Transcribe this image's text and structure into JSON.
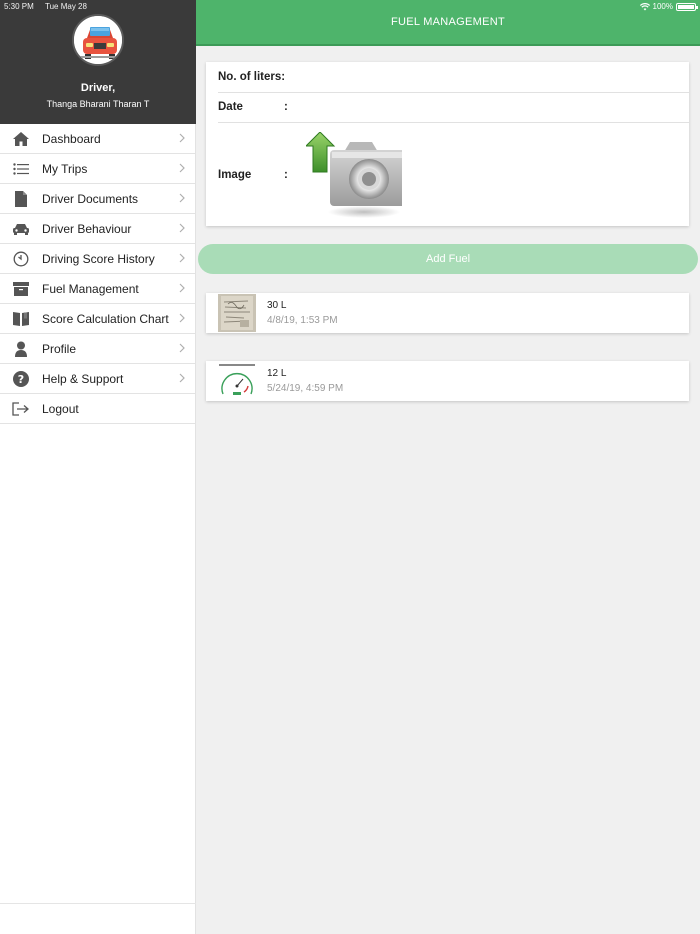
{
  "status_bar": {
    "time": "5:30 PM",
    "date": "Tue May 28",
    "battery": "100%"
  },
  "sidebar": {
    "driver_label": "Driver,",
    "driver_name": "Thanga Bharani Tharan T",
    "items": [
      {
        "label": "Dashboard",
        "icon": "home-icon",
        "has_chevron": true
      },
      {
        "label": "My Trips",
        "icon": "list-icon",
        "has_chevron": true
      },
      {
        "label": "Driver Documents",
        "icon": "document-icon",
        "has_chevron": true
      },
      {
        "label": "Driver Behaviour",
        "icon": "car-icon",
        "has_chevron": true
      },
      {
        "label": "Driving Score History",
        "icon": "timer-icon",
        "has_chevron": true
      },
      {
        "label": "Fuel Management",
        "icon": "archive-box-icon",
        "has_chevron": true
      },
      {
        "label": "Score Calculation Chart",
        "icon": "book-icon",
        "has_chevron": true
      },
      {
        "label": "Profile",
        "icon": "person-icon",
        "has_chevron": true
      },
      {
        "label": "Help & Support",
        "icon": "help-icon",
        "has_chevron": true
      },
      {
        "label": "Logout",
        "icon": "logout-icon",
        "has_chevron": false
      }
    ]
  },
  "header": {
    "title": "FUEL MANAGEMENT"
  },
  "form": {
    "liters_label": "No. of liters:",
    "date_label": "Date",
    "date_colon": ":",
    "image_label": "Image",
    "image_colon": ":"
  },
  "add_button": {
    "label": "Add Fuel"
  },
  "fuel_entries": [
    {
      "liters": "30 L",
      "datetime": "4/8/19, 1:53 PM",
      "thumbnail": "receipt-photo"
    },
    {
      "liters": "12 L",
      "datetime": "5/24/19, 4:59 PM",
      "thumbnail": "speedometer-photo"
    }
  ],
  "colors": {
    "header_green": "#4eb46b",
    "button_green_disabled": "#a9dcb7",
    "sidebar_header": "#3a3a3a",
    "background": "#f0f0f0"
  }
}
